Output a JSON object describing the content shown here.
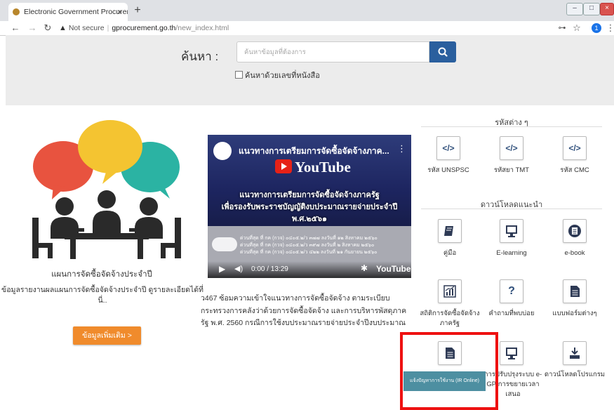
{
  "browser": {
    "tab_title": "Electronic Government Procurem",
    "tab_close": "×",
    "new_tab": "+",
    "url_security": "Not secure",
    "url_host": "gprocurement.go.th",
    "url_path": "/new_index.html",
    "profile_initial": "1"
  },
  "search": {
    "label": "ค้นหา :",
    "placeholder": "ค้นหาข้อมูลที่ต้องการ",
    "checkbox_label": "ค้นหาด้วยเลขที่หนังสือ"
  },
  "left": {
    "title": "แผนการจัดซื้อจัดจ้างประจำปี",
    "description": "ข้อมูลรายงานผลแผนการจัดซื้อจัดจ้างประจำปี ดูรายละเอียดได้ที่นี่..",
    "more_button": "ข้อมูลเพิ่มเติม >"
  },
  "video": {
    "title": "แนวทางการเตรียมการจัดซื้อจัดจ้างภาค...",
    "youtube": "YouTube",
    "line1": "แนวทางการเตรียมการจัดซื้อจัดจ้างภาครัฐ",
    "line2": "เพื่อรองรับพระราชบัญญัติงบประมาณรายจ่ายประจำปี",
    "line3": "พ.ศ.๒๕๖๑",
    "small1": "ด่วนที่สุด ที่ กค (กวจ) ๐๔๐๕.๒/ว ๓๗๗ ลงวันที่ ๑๒ สิงหาคม ๒๕๖๐",
    "small2": "ด่วนที่สุด ที่ กค (กวจ) ๐๔๐๕.๒/ว ๓๙๗ ลงวันที่ ๒ สิงหาคม ๒๕๖๐",
    "small3": "ด่วนที่สุด ที่ กค (กวจ) ๐๔๐๕.๒/ว ๔๒๒ ลงวันที่ ๒๑ กันยายน ๒๕๖๐",
    "time": "0:00 / 13:29",
    "youtube_small": "YouTube"
  },
  "article": {
    "text": "ว467 ซ้อมความเข้าใจแนวทางการจัดซื้อจัดจ้าง ตามระเบียบกระทรวงการคลังว่าด้วยการจัดซื้อจัดจ้าง และการบริหารพัสดุภาครัฐ พ.ศ. 2560 กรณีการใช้งบประมาณรายจ่ายประจำปีงบประมาณ"
  },
  "codes": {
    "title": "รหัสต่าง ๆ",
    "items": [
      {
        "icon": "</>",
        "label": "รหัส UNSPSC"
      },
      {
        "icon": "</>",
        "label": "รหัสยา TMT"
      },
      {
        "icon": "</>",
        "label": "รหัส CMC"
      }
    ]
  },
  "downloads": {
    "title": "ดาวน์โหลดแนะนำ",
    "row1": [
      {
        "label": "คู่มือ"
      },
      {
        "label": "E-learning"
      },
      {
        "label": "e-book"
      }
    ],
    "row2": [
      {
        "label": "สถิติการจัดซื้อจัดจ้างภาครัฐ"
      },
      {
        "icon": "?",
        "label": "คำถามที่พบบ่อย"
      },
      {
        "label": "แบบฟอร์มต่างๆ"
      }
    ],
    "row3": [
      {
        "label": ""
      },
      {
        "label": "การปรับปรุงระบบ e-GP/การขยายเวลาเสนอ"
      },
      {
        "label": "ดาวน์โหลดโปรแกรม"
      }
    ],
    "tooltip": "แจ้งปัญหาการใช้งาน (IR Online)"
  }
}
